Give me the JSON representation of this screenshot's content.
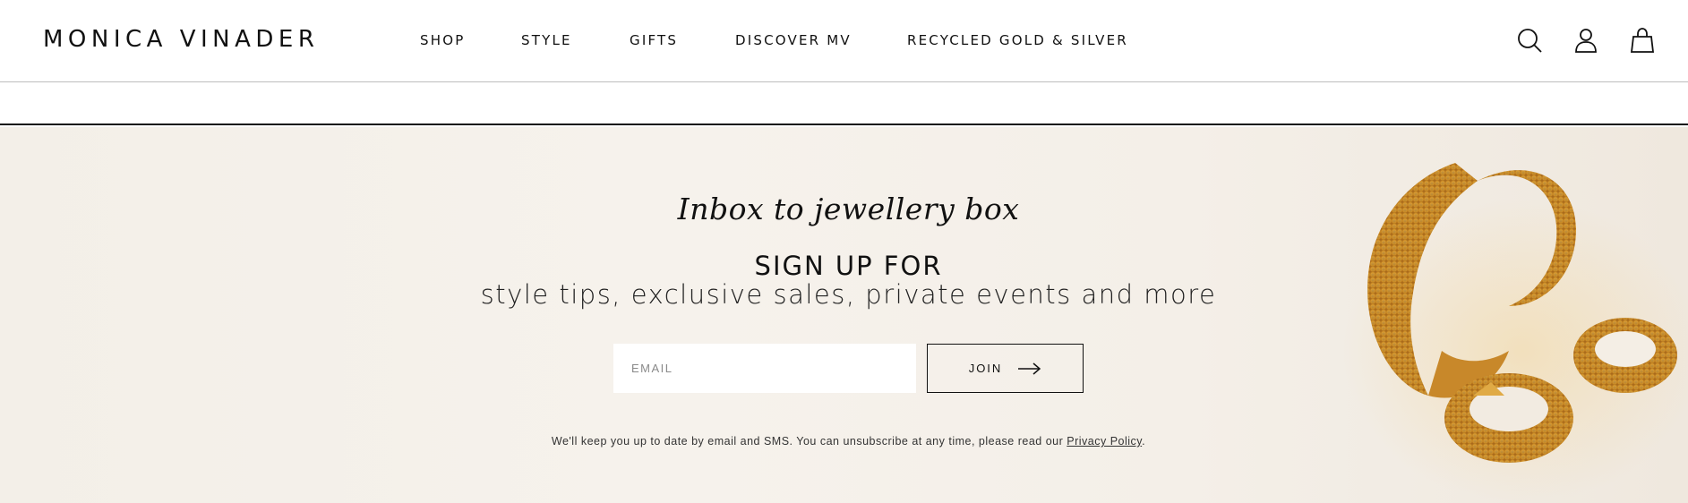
{
  "brand": {
    "name": "MONICA VINADER"
  },
  "nav": {
    "items": [
      {
        "label": "SHOP"
      },
      {
        "label": "STYLE"
      },
      {
        "label": "GIFTS"
      },
      {
        "label": "DISCOVER MV"
      },
      {
        "label": "RECYCLED GOLD & SILVER"
      }
    ]
  },
  "header_icons": [
    "search-icon",
    "account-icon",
    "bag-icon"
  ],
  "newsletter": {
    "tagline": "Inbox to jewellery box",
    "title": "SIGN UP FOR",
    "subtitle": "style tips, exclusive sales, private events and more",
    "email_placeholder": "EMAIL",
    "email_value": "",
    "join_label": "JOIN",
    "legal_text": "We'll keep you up to date by email and SMS. You can unsubscribe at any time, please read our ",
    "privacy_link": "Privacy Policy",
    "legal_end": "."
  },
  "colors": {
    "text": "#111111",
    "section_bg": "#f4f0ea",
    "gold": "#d9a23a"
  }
}
